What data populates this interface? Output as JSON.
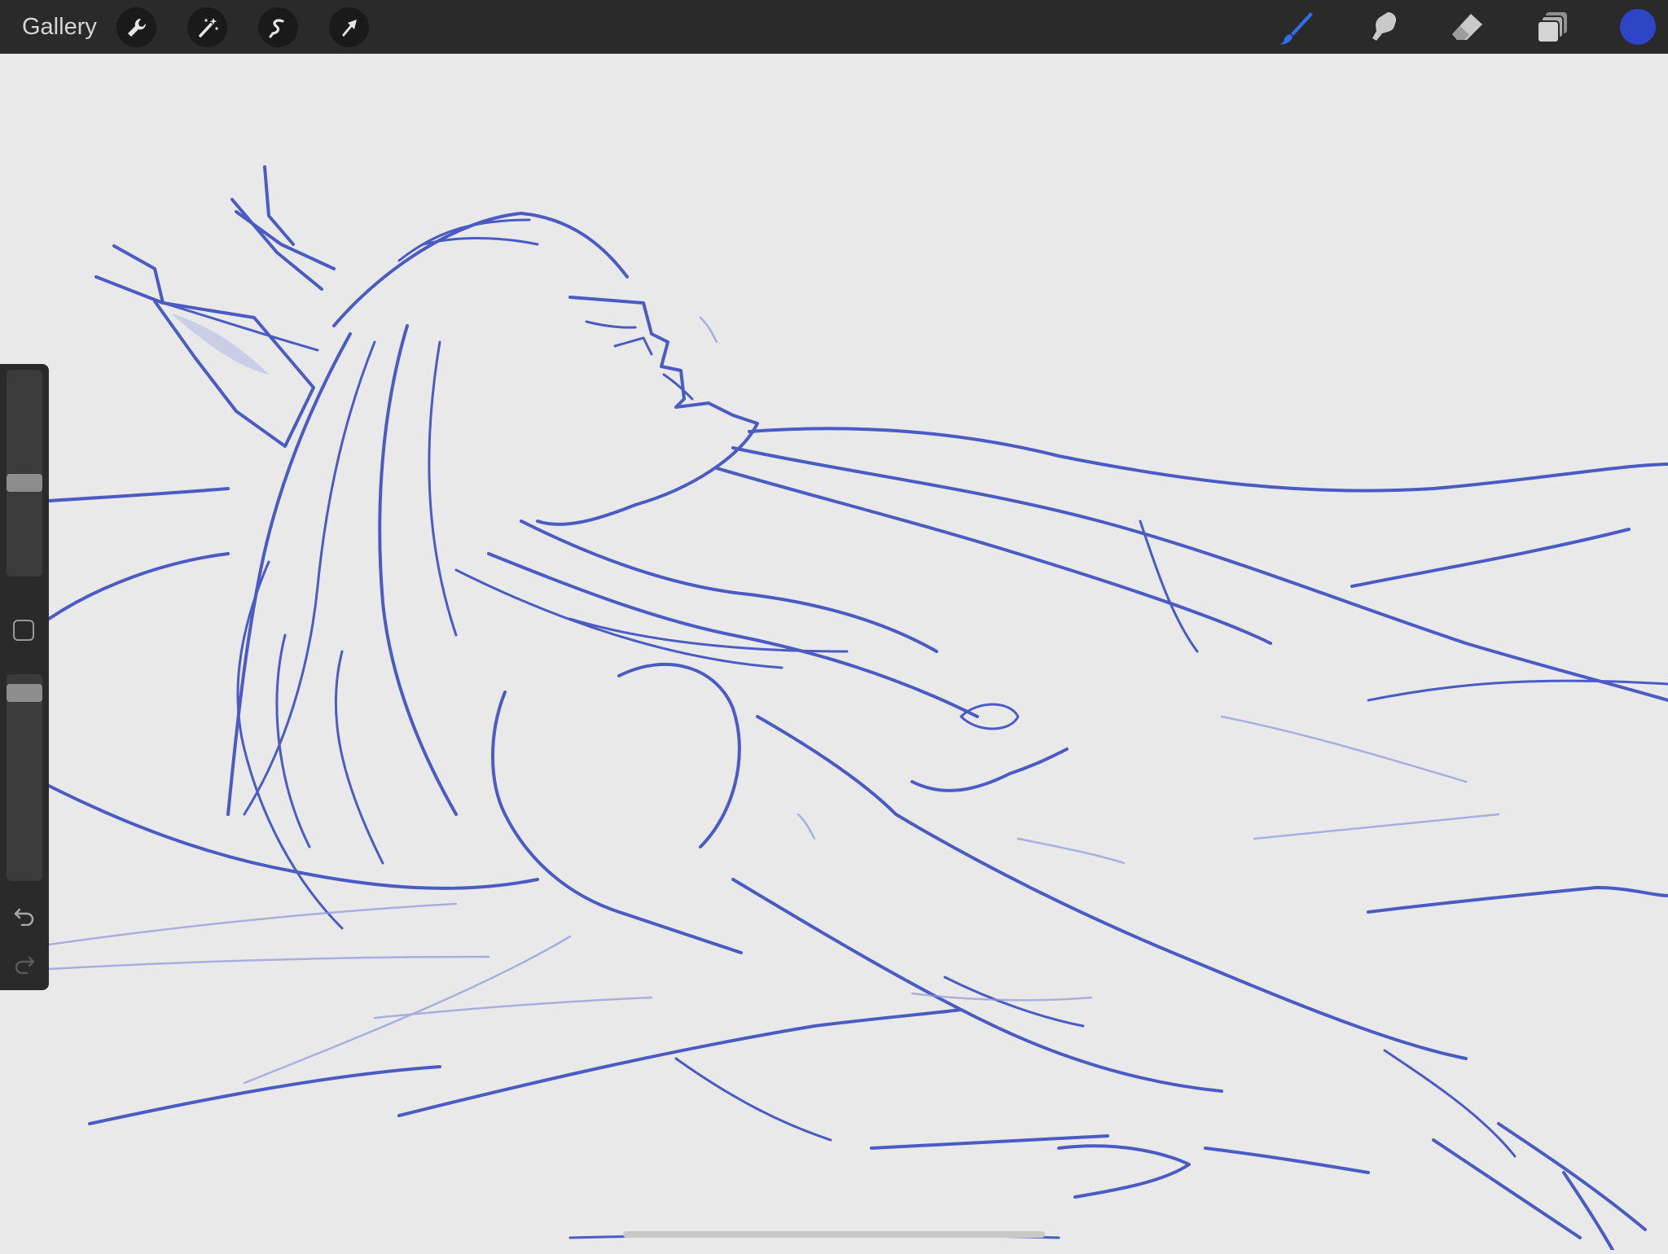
{
  "topbar": {
    "gallery_label": "Gallery",
    "left_tools": [
      "wrench-icon",
      "magic-wand-icon",
      "selection-icon",
      "transform-arrow-icon"
    ],
    "right_tools": [
      "brush-icon",
      "smudge-icon",
      "eraser-icon",
      "layers-icon"
    ]
  },
  "colors": {
    "accent_brush": "#2f6ee8",
    "current_color": "#2f45c8",
    "stroke": "#4a5cc4",
    "toolbar_bg": "#2a2a2b",
    "canvas_bg": "#e9e9e9"
  },
  "sidebar": {
    "brush_size_level": 0.45,
    "opacity_level": 0.95,
    "undo_icon": "undo-icon",
    "redo_icon": "redo-icon"
  }
}
